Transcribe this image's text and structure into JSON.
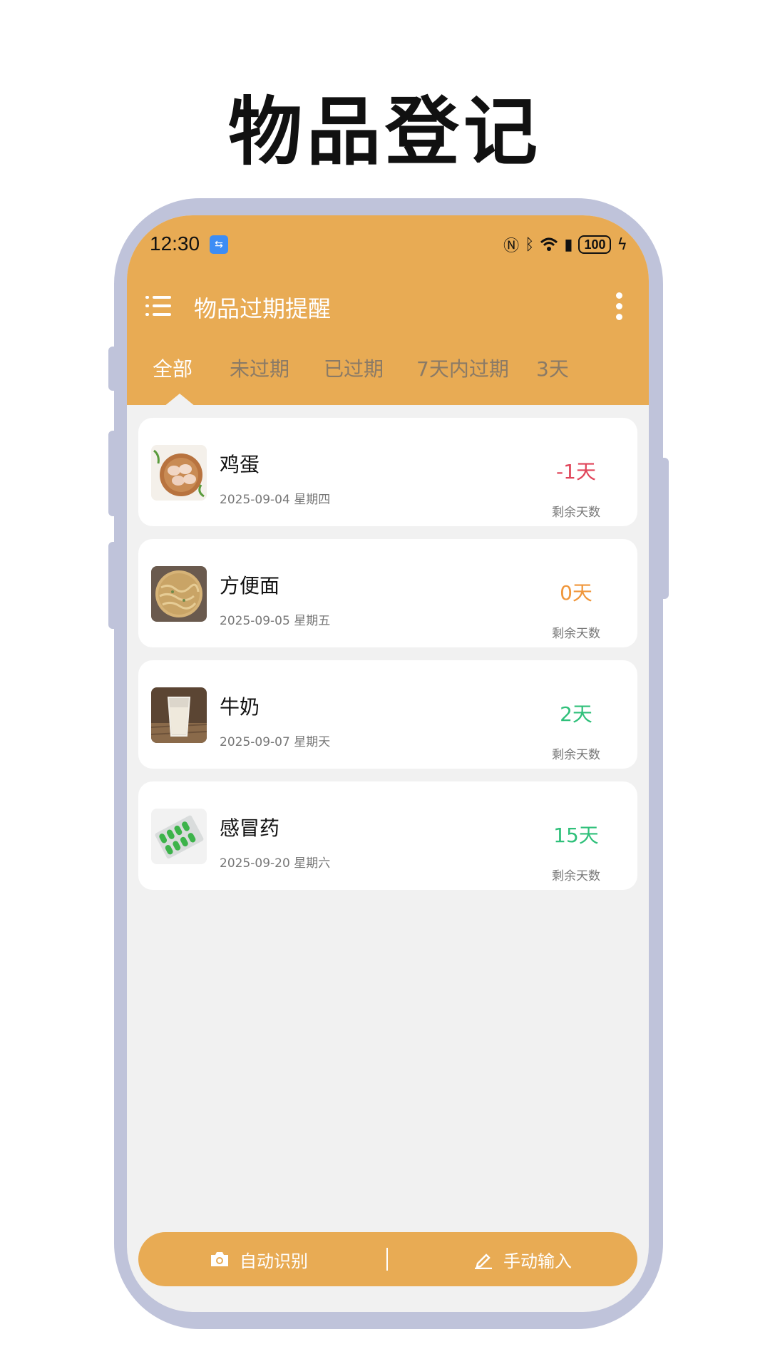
{
  "promo_title": "物品登记",
  "status_bar": {
    "time": "12:30",
    "battery": "100"
  },
  "app_bar": {
    "title": "物品过期提醒"
  },
  "tabs": [
    {
      "label": "全部",
      "active": true
    },
    {
      "label": "未过期",
      "active": false
    },
    {
      "label": "已过期",
      "active": false
    },
    {
      "label": "7天内过期",
      "active": false
    },
    {
      "label": "3天",
      "active": false
    }
  ],
  "items": [
    {
      "name": "鸡蛋",
      "date": "2025-09-04  星期四",
      "days": "-1天",
      "days_label": "剩余天数",
      "days_color": "#e0455a",
      "icon": "eggs-image"
    },
    {
      "name": "方便面",
      "date": "2025-09-05  星期五",
      "days": "0天",
      "days_label": "剩余天数",
      "days_color": "#f0963a",
      "icon": "instant-noodles-image"
    },
    {
      "name": "牛奶",
      "date": "2025-09-07  星期天",
      "days": "2天",
      "days_label": "剩余天数",
      "days_color": "#2fc07a",
      "icon": "milk-image"
    },
    {
      "name": "感冒药",
      "date": "2025-09-20  星期六",
      "days": "15天",
      "days_label": "剩余天数",
      "days_color": "#2fc07a",
      "icon": "medicine-image"
    }
  ],
  "bottom_bar": {
    "auto_label": "自动识别",
    "manual_label": "手动输入"
  },
  "colors": {
    "accent": "#e8ab54",
    "background": "#f1f1f1",
    "frame": "#bfc3da"
  }
}
